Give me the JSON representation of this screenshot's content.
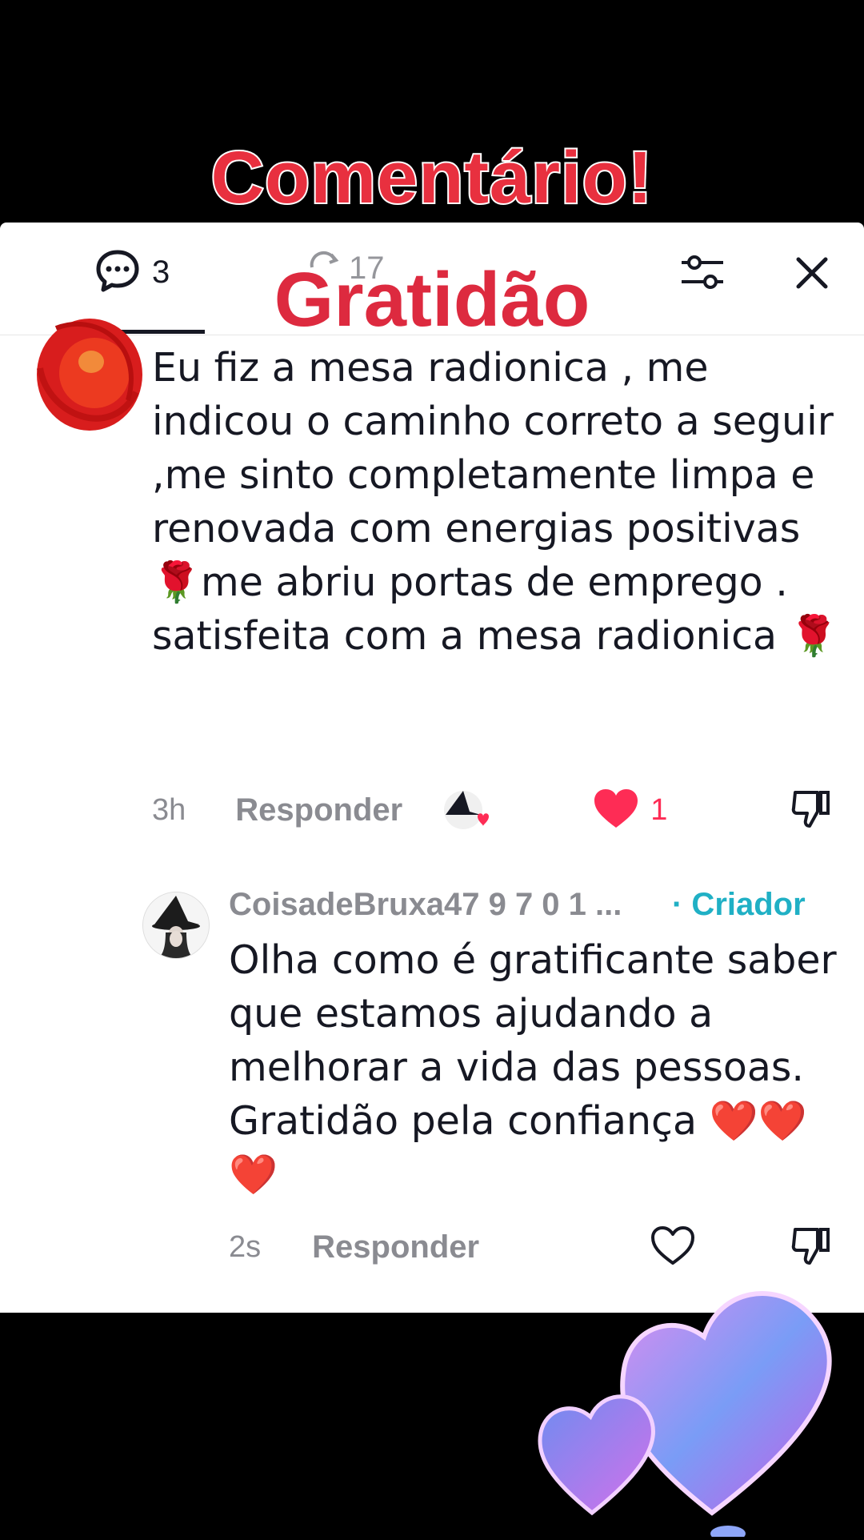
{
  "overlay": {
    "title_top": "Comentário!",
    "title_mid": "Gratidão"
  },
  "tabs": {
    "comments_count": "3",
    "reposts_count": "17"
  },
  "comments": [
    {
      "text": "Eu fiz a mesa radionica , me indicou o caminho correto a seguir ,me sinto completamente limpa e renovada com energias positivas 🌹me abriu portas de emprego . satisfeita com a mesa radionica 🌹",
      "time": "3h",
      "reply_label": "Responder",
      "likes": "1",
      "liked_by_creator": true
    }
  ],
  "reply": {
    "username": "CoisadeBruxa47 9 7 0 1 ...",
    "badge": "· Criador",
    "text": "Olha como é gratificante saber que estamos ajudando a melhorar a vida das pessoas. Gratidão pela confiança ❤️❤️❤️",
    "time": "2s",
    "reply_label": "Responder"
  },
  "colors": {
    "accent_red": "#fe2c55",
    "creator_teal": "#20b0c5",
    "overlay_red": "#e8303f"
  },
  "icons": [
    "comment-icon",
    "repost-icon",
    "filter-icon",
    "close-icon",
    "heart-icon",
    "dislike-icon",
    "hearts-sticker"
  ]
}
